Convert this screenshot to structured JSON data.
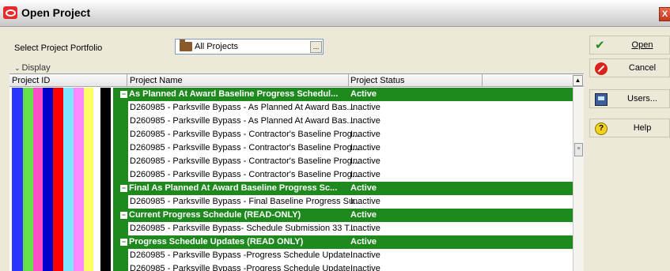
{
  "window": {
    "title": "Open Project",
    "close_glyph": "X"
  },
  "portfolio": {
    "label": "Select Project Portfolio",
    "value": "All Projects",
    "browse_label": "..."
  },
  "display_toggle": "Display",
  "columns": {
    "project_id": "Project ID",
    "project_name": "Project Name",
    "project_status": "Project Status"
  },
  "stripe_colors": [
    "#ffffff",
    "#2a35ff",
    "#66e04a",
    "#ff4ec8",
    "#0000cc",
    "#ff0000",
    "#7ee6ff",
    "#ff88ff",
    "#ffff66",
    "#ffffff",
    "#000000",
    "#ffffff",
    "#1e8a1e"
  ],
  "rows": [
    {
      "type": "group",
      "name": "As Planned At Award Baseline Progress Schedul...",
      "status": "Active"
    },
    {
      "type": "item",
      "name": "D260985 - Parksville Bypass - As Planned At Award Bas...",
      "status": "Inactive"
    },
    {
      "type": "item",
      "name": "D260985 - Parksville Bypass - As Planned At Award Bas...",
      "status": "Inactive"
    },
    {
      "type": "item",
      "name": "D260985 - Parksville Bypass - Contractor's Baseline Prog...",
      "status": "Inactive"
    },
    {
      "type": "item",
      "name": "D260985 - Parksville Bypass - Contractor's Baseline Prog...",
      "status": "Inactive"
    },
    {
      "type": "item",
      "name": "D260985 - Parksville Bypass - Contractor's Baseline Prog...",
      "status": "Inactive"
    },
    {
      "type": "item",
      "name": "D260985 - Parksville Bypass - Contractor's Baseline Prog...",
      "status": "Inactive"
    },
    {
      "type": "group",
      "name": "Final As Planned At Award Baseline Progress Sc...",
      "status": "Active"
    },
    {
      "type": "item",
      "name": "D260985 - Parksville Bypass - Final Baseline Progress Su...",
      "status": "Inactive"
    },
    {
      "type": "group",
      "name": "Current Progress Schedule (READ-ONLY)",
      "status": "Active"
    },
    {
      "type": "item",
      "name": "D260985 - Parksville Bypass- Schedule Submission 33 T...",
      "status": "Inactive"
    },
    {
      "type": "group",
      "name": "Progress Schedule Updates (READ ONLY)",
      "status": "Active"
    },
    {
      "type": "item",
      "name": "D260985 - Parksville Bypass -Progress Schedule Update...",
      "status": "Inactive"
    },
    {
      "type": "item",
      "name": "D260985 - Parksville Bypass -Progress Schedule Update...",
      "status": "Inactive"
    }
  ],
  "buttons": {
    "open": "Open",
    "cancel": "Cancel",
    "users": "Users...",
    "help": "Help"
  },
  "icons": {
    "expand": "minus-box-icon",
    "ok": "checkmark-icon",
    "cancel": "stop-icon",
    "users": "monitor-users-icon",
    "help": "question-icon"
  }
}
